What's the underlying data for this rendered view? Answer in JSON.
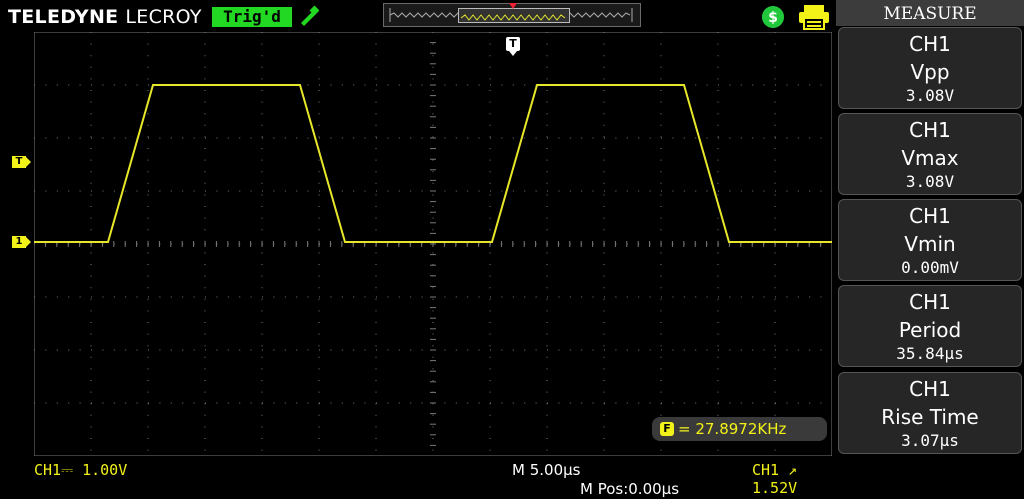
{
  "header": {
    "brand_bold": "TELEDYNE",
    "brand_light": "LECROY",
    "status": "Trig'd"
  },
  "markers": {
    "trigger_level": "T",
    "channel1": "1",
    "trigger_position": "T"
  },
  "display": {
    "frequency_icon": "F",
    "frequency": "27.8972KHz",
    "waveform_color": "#e6e62a",
    "grid_color": "#7a7a7a"
  },
  "bottom": {
    "channel_scale": "CH1⎓ 1.00V",
    "timebase": "M 5.00μs",
    "time_position": "M Pos:0.00μs",
    "trigger": "CH1 ↗ 1.52V"
  },
  "measure": {
    "title": "MEASURE",
    "items": [
      {
        "channel": "CH1",
        "name": "Vpp",
        "value": "3.08V"
      },
      {
        "channel": "CH1",
        "name": "Vmax",
        "value": "3.08V"
      },
      {
        "channel": "CH1",
        "name": "Vmin",
        "value": "0.00mV"
      },
      {
        "channel": "CH1",
        "name": "Period",
        "value": "35.84μs"
      },
      {
        "channel": "CH1",
        "name": "Rise Time",
        "value": "3.07μs"
      }
    ]
  },
  "icons": [
    "usb-icon",
    "dollar-icon",
    "printer-icon"
  ]
}
